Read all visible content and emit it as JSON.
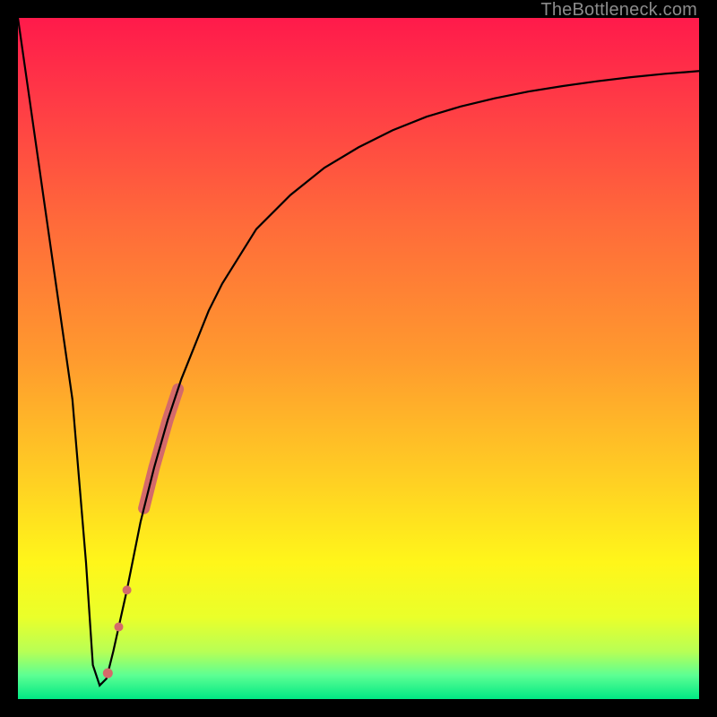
{
  "watermark": "TheBottleneck.com",
  "chart_data": {
    "type": "line",
    "title": "",
    "xlabel": "",
    "ylabel": "",
    "xlim": [
      0,
      100
    ],
    "ylim": [
      0,
      100
    ],
    "grid": false,
    "series": [
      {
        "name": "curve",
        "color": "#000000",
        "x": [
          0,
          2,
          4,
          6,
          8,
          10,
          11,
          12,
          13,
          14,
          16,
          18,
          20,
          22,
          24,
          26,
          28,
          30,
          35,
          40,
          45,
          50,
          55,
          60,
          65,
          70,
          75,
          80,
          85,
          90,
          95,
          100
        ],
        "y": [
          100,
          86,
          72,
          58,
          44,
          20,
          5,
          2,
          3,
          7,
          16,
          26,
          34,
          41,
          47,
          52,
          57,
          61,
          69,
          74,
          78,
          81,
          83.5,
          85.5,
          87,
          88.2,
          89.2,
          90,
          90.7,
          91.3,
          91.8,
          92.2
        ]
      }
    ],
    "markers": [
      {
        "name": "dot1",
        "x": 13.2,
        "y": 5.0,
        "r": 5.5,
        "color": "#d46a6a"
      },
      {
        "name": "dot2",
        "x": 14.8,
        "y": 10.5,
        "r": 5.0,
        "color": "#d46a6a"
      },
      {
        "name": "dot3",
        "x": 16.0,
        "y": 16.0,
        "r": 5.0,
        "color": "#d46a6a"
      },
      {
        "name": "band_start_x",
        "x": 18.5,
        "y": 27.0,
        "r": 6.5,
        "color": "#d46a6a"
      },
      {
        "name": "band_end_x",
        "x": 23.5,
        "y": 45.0,
        "r": 6.5,
        "color": "#d46a6a"
      }
    ],
    "background_gradient": {
      "type": "vertical",
      "stops": [
        {
          "offset": 0.0,
          "color": "#ff1a4b"
        },
        {
          "offset": 0.12,
          "color": "#ff3a46"
        },
        {
          "offset": 0.3,
          "color": "#ff6a3a"
        },
        {
          "offset": 0.5,
          "color": "#ff9a2e"
        },
        {
          "offset": 0.68,
          "color": "#ffd023"
        },
        {
          "offset": 0.8,
          "color": "#fff61a"
        },
        {
          "offset": 0.88,
          "color": "#eaff2a"
        },
        {
          "offset": 0.93,
          "color": "#b8ff55"
        },
        {
          "offset": 0.965,
          "color": "#5dff93"
        },
        {
          "offset": 1.0,
          "color": "#00e884"
        }
      ]
    }
  }
}
